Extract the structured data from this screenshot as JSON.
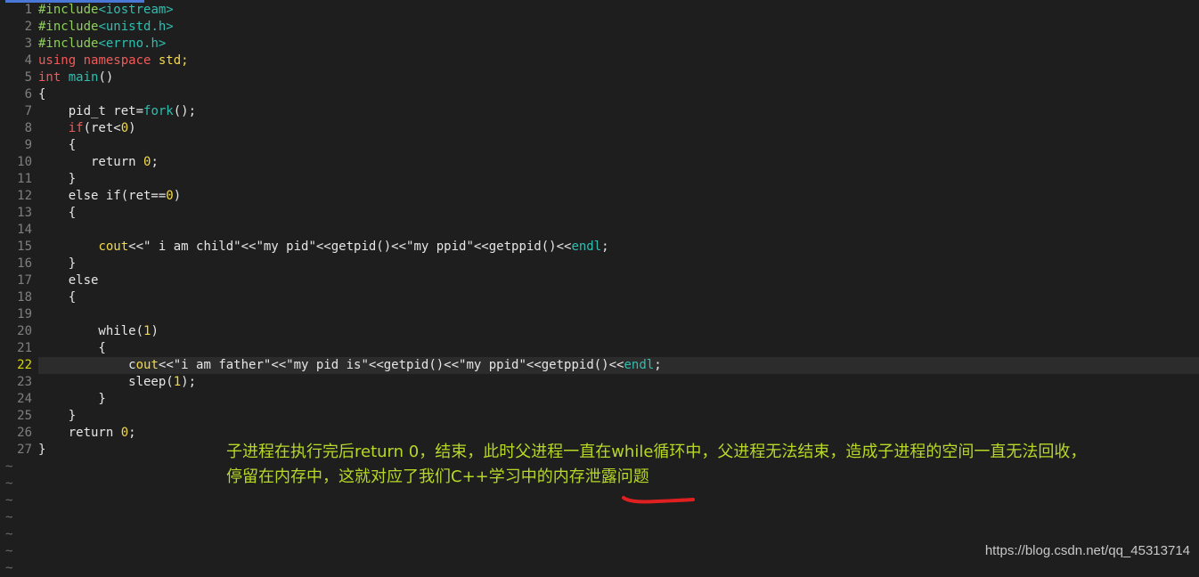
{
  "editor": {
    "lines": [
      {
        "num": "1",
        "segments": [
          {
            "t": "#include",
            "c": "preproc"
          },
          {
            "t": "<iostream>",
            "c": "builtin"
          }
        ]
      },
      {
        "num": "2",
        "segments": [
          {
            "t": "#include",
            "c": "preproc"
          },
          {
            "t": "<unistd.h>",
            "c": "builtin"
          }
        ]
      },
      {
        "num": "3",
        "segments": [
          {
            "t": "#include",
            "c": "preproc"
          },
          {
            "t": "<errno.h>",
            "c": "builtin"
          }
        ]
      },
      {
        "num": "4",
        "segments": [
          {
            "t": "using",
            "c": "keyword"
          },
          {
            "t": " ",
            "c": "text"
          },
          {
            "t": "namespace",
            "c": "keyword"
          },
          {
            "t": " std;",
            "c": "ident-yellow"
          }
        ]
      },
      {
        "num": "5",
        "segments": [
          {
            "t": "int",
            "c": "type"
          },
          {
            "t": " ",
            "c": "text"
          },
          {
            "t": "main",
            "c": "func"
          },
          {
            "t": "()",
            "c": "text"
          }
        ]
      },
      {
        "num": "6",
        "segments": [
          {
            "t": "{",
            "c": "text"
          }
        ]
      },
      {
        "num": "7",
        "segments": [
          {
            "t": "    pid_t ret=",
            "c": "text"
          },
          {
            "t": "fork",
            "c": "func"
          },
          {
            "t": "();",
            "c": "text"
          }
        ]
      },
      {
        "num": "8",
        "segments": [
          {
            "t": "    ",
            "c": "text"
          },
          {
            "t": "if",
            "c": "keyword"
          },
          {
            "t": "(ret<",
            "c": "text"
          },
          {
            "t": "0",
            "c": "number"
          },
          {
            "t": ")",
            "c": "text"
          }
        ]
      },
      {
        "num": "9",
        "segments": [
          {
            "t": "    {",
            "c": "text"
          }
        ]
      },
      {
        "num": "10",
        "segments": [
          {
            "t": "       return ",
            "c": "text"
          },
          {
            "t": "0",
            "c": "number"
          },
          {
            "t": ";",
            "c": "text"
          }
        ]
      },
      {
        "num": "11",
        "segments": [
          {
            "t": "    }",
            "c": "text"
          }
        ]
      },
      {
        "num": "12",
        "segments": [
          {
            "t": "    else if(ret==",
            "c": "text"
          },
          {
            "t": "0",
            "c": "number"
          },
          {
            "t": ")",
            "c": "text"
          }
        ]
      },
      {
        "num": "13",
        "segments": [
          {
            "t": "    {",
            "c": "text"
          }
        ]
      },
      {
        "num": "14",
        "segments": []
      },
      {
        "num": "15",
        "segments": [
          {
            "t": "        ",
            "c": "text"
          },
          {
            "t": "cout",
            "c": "ident-yellow"
          },
          {
            "t": "<<\" i am child\"<<\"my pid\"<<getpid()<<\"my ppid\"<<getppid()<<",
            "c": "text"
          },
          {
            "t": "endl",
            "c": "builtin"
          },
          {
            "t": ";",
            "c": "text"
          }
        ]
      },
      {
        "num": "16",
        "segments": [
          {
            "t": "    }",
            "c": "text"
          }
        ]
      },
      {
        "num": "17",
        "segments": [
          {
            "t": "    else",
            "c": "text"
          }
        ]
      },
      {
        "num": "18",
        "segments": [
          {
            "t": "    {",
            "c": "text"
          }
        ]
      },
      {
        "num": "19",
        "segments": []
      },
      {
        "num": "20",
        "segments": [
          {
            "t": "        while(",
            "c": "text"
          },
          {
            "t": "1",
            "c": "number"
          },
          {
            "t": ")",
            "c": "text"
          }
        ]
      },
      {
        "num": "21",
        "segments": [
          {
            "t": "        {",
            "c": "text"
          }
        ]
      },
      {
        "num": "22",
        "current": true,
        "segments": [
          {
            "t": "            ",
            "c": "text"
          },
          {
            "t": "c",
            "c": "cursor"
          },
          {
            "t": "out",
            "c": "ident-yellow"
          },
          {
            "t": "<<\"i am father\"<<\"my pid is\"<<getpid()<<\"my ppid\"<<getppid()<<",
            "c": "text"
          },
          {
            "t": "endl",
            "c": "builtin"
          },
          {
            "t": ";",
            "c": "text"
          }
        ]
      },
      {
        "num": "23",
        "segments": [
          {
            "t": "            sleep(",
            "c": "text"
          },
          {
            "t": "1",
            "c": "number"
          },
          {
            "t": ");",
            "c": "text"
          }
        ]
      },
      {
        "num": "24",
        "segments": [
          {
            "t": "        }",
            "c": "text"
          }
        ]
      },
      {
        "num": "25",
        "segments": [
          {
            "t": "    }",
            "c": "text"
          }
        ]
      },
      {
        "num": "26",
        "segments": [
          {
            "t": "    return ",
            "c": "text"
          },
          {
            "t": "0",
            "c": "number"
          },
          {
            "t": ";",
            "c": "text"
          }
        ]
      },
      {
        "num": "27",
        "segments": [
          {
            "t": "}",
            "c": "text"
          }
        ]
      }
    ],
    "tilde_rows": [
      "~",
      "~",
      "~",
      "~",
      "~",
      "~",
      "~"
    ]
  },
  "annotation": {
    "line1": "子进程在执行完后return 0，结束，此时父进程一直在while循环中，父进程无法结束，造成子进程的空间一直无法回收，",
    "line2": "停留在内存中，这就对应了我们C++学习中的内存泄露问题"
  },
  "watermark": "https://blog.csdn.net/qq_45313714",
  "colors": {
    "background": "#1e1e1e",
    "annotation": "#b7d826",
    "underline": "#e02020",
    "cursor": "#39c51a"
  }
}
